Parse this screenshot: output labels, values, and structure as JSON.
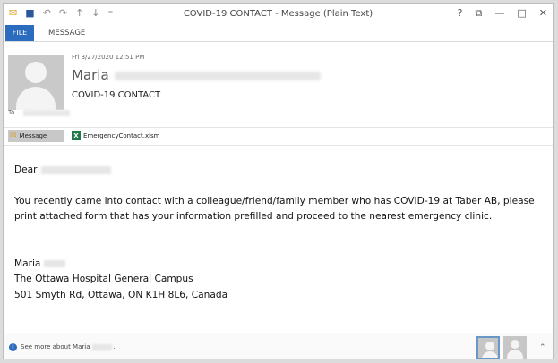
{
  "window": {
    "title": "COVID-19 CONTACT - Message (Plain Text)",
    "controls": [
      "?",
      "⧉",
      "—",
      "□",
      "✕"
    ]
  },
  "qat_icons": [
    "mail-icon",
    "save-icon",
    "undo-icon",
    "redo-icon",
    "up-icon",
    "down-icon",
    "customize-icon"
  ],
  "ribbon": {
    "file_tab": "FILE",
    "message_tab": "MESSAGE"
  },
  "header": {
    "date": "Fri 3/27/2020 12:51 PM",
    "sender_name": "Maria",
    "subject": "COVID-19 CONTACT",
    "to_label": "To"
  },
  "attachments": {
    "message_label": "Message",
    "file_name": "EmergencyContact.xlsm"
  },
  "body": {
    "greeting": "Dear",
    "paragraph": "You recently came into contact with a colleague/friend/family member who has COVID-19 at  Taber AB, please print attached form that has your information prefilled and proceed to the nearest emergency clinic.",
    "signature_name": "Maria",
    "signature_org": "The Ottawa Hospital General Campus",
    "signature_address": "501 Smyth Rd, Ottawa, ON K1H 8L6, Canada"
  },
  "footer": {
    "see_more": "See more about Maria",
    "see_more_suffix": "."
  },
  "colors": {
    "accent": "#2b6cbf",
    "excel": "#1f7b45"
  }
}
